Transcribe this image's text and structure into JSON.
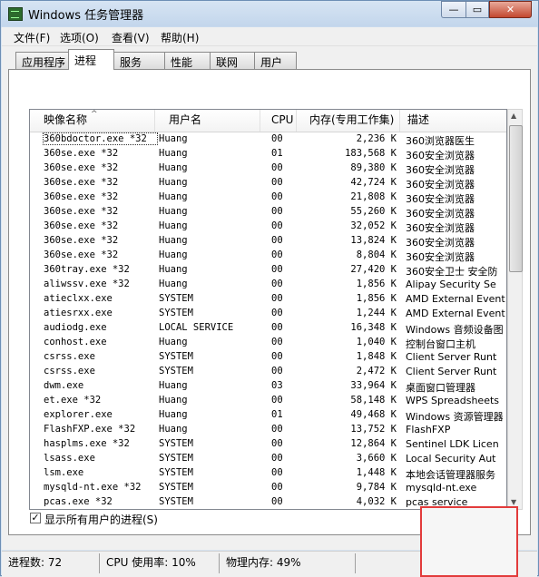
{
  "window": {
    "title": "Windows 任务管理器",
    "close_glyph": "✕",
    "max_glyph": "▭",
    "min_glyph": "—"
  },
  "menu": [
    "文件(F)",
    "选项(O)",
    "查看(V)",
    "帮助(H)"
  ],
  "tabs": [
    "应用程序",
    "进程",
    "服务",
    "性能",
    "联网",
    "用户"
  ],
  "active_tab": "进程",
  "columns": [
    "映像名称",
    "用户名",
    "CPU",
    "内存(专用工作集)",
    "描述"
  ],
  "sort_arrow": "^",
  "rows": [
    {
      "name": "360bdoctor.exe *32",
      "user": "Huang",
      "cpu": "00",
      "mem": "2,236 K",
      "desc": "360浏览器医生"
    },
    {
      "name": "360se.exe *32",
      "user": "Huang",
      "cpu": "01",
      "mem": "183,568 K",
      "desc": "360安全浏览器"
    },
    {
      "name": "360se.exe *32",
      "user": "Huang",
      "cpu": "00",
      "mem": "89,380 K",
      "desc": "360安全浏览器"
    },
    {
      "name": "360se.exe *32",
      "user": "Huang",
      "cpu": "00",
      "mem": "42,724 K",
      "desc": "360安全浏览器"
    },
    {
      "name": "360se.exe *32",
      "user": "Huang",
      "cpu": "00",
      "mem": "21,808 K",
      "desc": "360安全浏览器"
    },
    {
      "name": "360se.exe *32",
      "user": "Huang",
      "cpu": "00",
      "mem": "55,260 K",
      "desc": "360安全浏览器"
    },
    {
      "name": "360se.exe *32",
      "user": "Huang",
      "cpu": "00",
      "mem": "32,052 K",
      "desc": "360安全浏览器"
    },
    {
      "name": "360se.exe *32",
      "user": "Huang",
      "cpu": "00",
      "mem": "13,824 K",
      "desc": "360安全浏览器"
    },
    {
      "name": "360se.exe *32",
      "user": "Huang",
      "cpu": "00",
      "mem": "8,804 K",
      "desc": "360安全浏览器"
    },
    {
      "name": "360tray.exe *32",
      "user": "Huang",
      "cpu": "00",
      "mem": "27,420 K",
      "desc": "360安全卫士 安全防"
    },
    {
      "name": "aliwssv.exe *32",
      "user": "Huang",
      "cpu": "00",
      "mem": "1,856 K",
      "desc": "Alipay Security Se"
    },
    {
      "name": "atieclxx.exe",
      "user": "SYSTEM",
      "cpu": "00",
      "mem": "1,856 K",
      "desc": "AMD External Event"
    },
    {
      "name": "atiesrxx.exe",
      "user": "SYSTEM",
      "cpu": "00",
      "mem": "1,244 K",
      "desc": "AMD External Event"
    },
    {
      "name": "audiodg.exe",
      "user": "LOCAL SERVICE",
      "cpu": "00",
      "mem": "16,348 K",
      "desc": "Windows 音频设备图"
    },
    {
      "name": "conhost.exe",
      "user": "Huang",
      "cpu": "00",
      "mem": "1,040 K",
      "desc": "控制台窗口主机"
    },
    {
      "name": "csrss.exe",
      "user": "SYSTEM",
      "cpu": "00",
      "mem": "1,848 K",
      "desc": "Client Server Runt"
    },
    {
      "name": "csrss.exe",
      "user": "SYSTEM",
      "cpu": "00",
      "mem": "2,472 K",
      "desc": "Client Server Runt"
    },
    {
      "name": "dwm.exe",
      "user": "Huang",
      "cpu": "03",
      "mem": "33,964 K",
      "desc": "桌面窗口管理器"
    },
    {
      "name": "et.exe *32",
      "user": "Huang",
      "cpu": "00",
      "mem": "58,148 K",
      "desc": "WPS Spreadsheets"
    },
    {
      "name": "explorer.exe",
      "user": "Huang",
      "cpu": "01",
      "mem": "49,468 K",
      "desc": "Windows 资源管理器"
    },
    {
      "name": "FlashFXP.exe *32",
      "user": "Huang",
      "cpu": "00",
      "mem": "13,752 K",
      "desc": "FlashFXP"
    },
    {
      "name": "hasplms.exe *32",
      "user": "SYSTEM",
      "cpu": "00",
      "mem": "12,864 K",
      "desc": "Sentinel LDK Licen"
    },
    {
      "name": "lsass.exe",
      "user": "SYSTEM",
      "cpu": "00",
      "mem": "3,660 K",
      "desc": "Local Security Aut"
    },
    {
      "name": "lsm.exe",
      "user": "SYSTEM",
      "cpu": "00",
      "mem": "1,448 K",
      "desc": "本地会话管理器服务"
    },
    {
      "name": "mysqld-nt.exe *32",
      "user": "SYSTEM",
      "cpu": "00",
      "mem": "9,784 K",
      "desc": "mysqld-nt.exe"
    },
    {
      "name": "pcas.exe *32",
      "user": "SYSTEM",
      "cpu": "00",
      "mem": "4,032 K",
      "desc": "pcas service"
    }
  ],
  "show_all_users": {
    "label": "显示所有用户的进程(S)",
    "checked_glyph": "✓"
  },
  "scroll": {
    "up": "▲",
    "down": "▼",
    "left": "◀",
    "right": "▶",
    "grip": "|||"
  },
  "status": {
    "processes": "进程数: 72",
    "cpu": "CPU 使用率: 10%",
    "memory": "物理内存: 49%"
  },
  "colors": {
    "title_bar": "#c3d6ec",
    "close_button": "#c3482f",
    "highlight_box": "#e23b3b"
  }
}
